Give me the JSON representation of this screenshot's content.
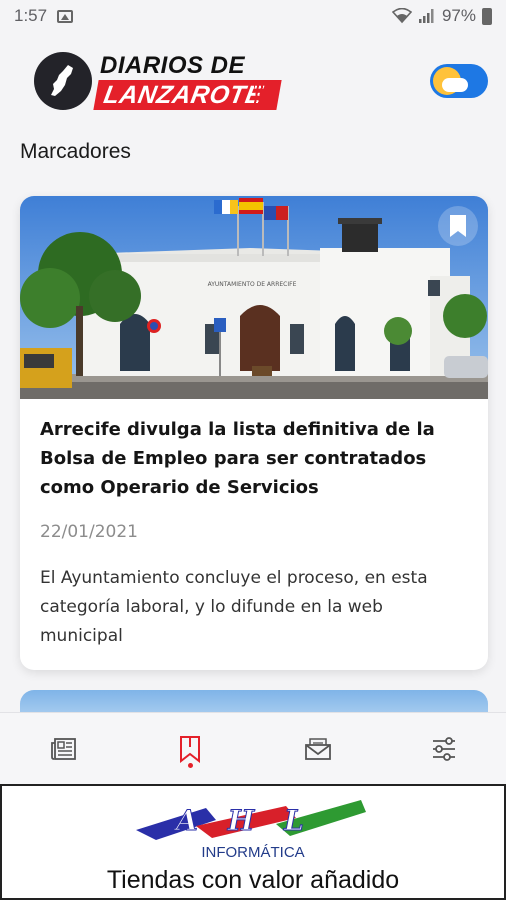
{
  "status_bar": {
    "time": "1:57",
    "battery": "97%"
  },
  "header": {
    "logo_line1": "DIARIOS DE",
    "logo_line2": "LANZAROTE",
    "weather_toggle_icon": "sun-cloud-icon"
  },
  "page": {
    "title": "Marcadores"
  },
  "articles": [
    {
      "photo_sign": "AYUNTAMIENTO DE ARRECIFE",
      "title": "Arrecife divulga la lista definitiva de la Bolsa de Empleo para ser contratados como Operario de Servicios",
      "date": "22/01/2021",
      "description": "El Ayuntamiento concluye el proceso, en esta categoría laboral, y lo difunde en la web municipal"
    }
  ],
  "tab_bar": {
    "tabs": [
      {
        "icon": "newspaper-icon"
      },
      {
        "icon": "bookmark-icon",
        "active": true
      },
      {
        "icon": "mail-icon"
      },
      {
        "icon": "settings-sliders-icon"
      }
    ],
    "active_color": "#e4202a"
  },
  "ad": {
    "brand": "AHL",
    "subtitle": "INFORMÁTICA",
    "tagline": "Tiendas con valor añadido"
  },
  "colors": {
    "brand_red": "#e4202a",
    "toggle_blue": "#1e78e4",
    "background": "#f4f4f6"
  }
}
